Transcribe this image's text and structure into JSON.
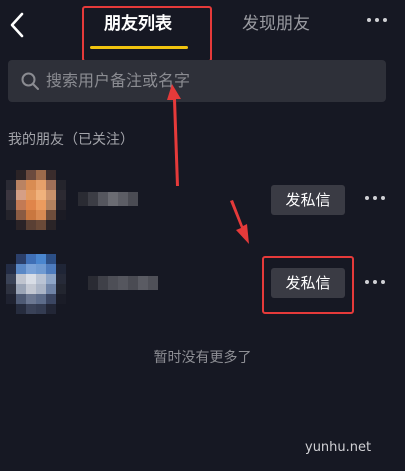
{
  "header": {
    "tabs": [
      {
        "label": "朋友列表",
        "active": true
      },
      {
        "label": "发现朋友",
        "active": false
      }
    ],
    "back_icon": "chevron-left-icon",
    "more_icon": "more-horizontal-icon"
  },
  "search": {
    "placeholder": "搜索用户备注或名字",
    "icon": "search-icon"
  },
  "friends": {
    "section_title": "我的朋友（已关注）",
    "items": [
      {
        "name": "",
        "button_label": "发私信"
      },
      {
        "name": "",
        "button_label": "发私信"
      }
    ],
    "empty_text": "暂时没有更多了"
  },
  "watermark": "yunhu.net",
  "colors": {
    "background": "#161823",
    "accent_tab": "#f1c40f",
    "highlight": "#e53a3a",
    "button_bg": "#3a3b44",
    "search_bg": "#2e3039"
  }
}
